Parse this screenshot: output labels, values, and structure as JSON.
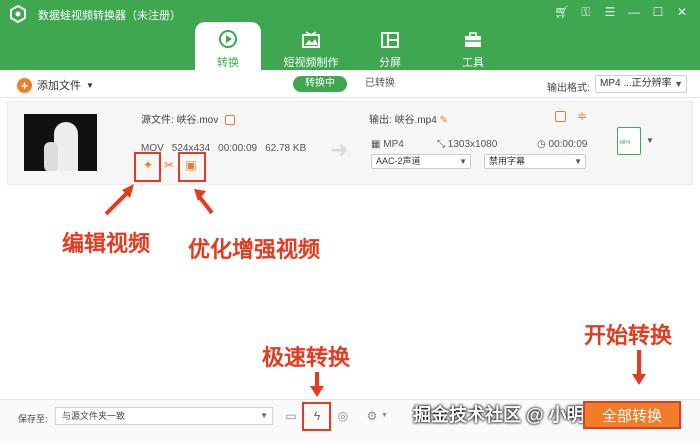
{
  "app": {
    "title": "数据蛙视频转换器（未注册）",
    "accent": "#3ea74f",
    "highlight": "#f07c2a",
    "annotation_color": "#e23b1f"
  },
  "window_controls": [
    "cart-icon",
    "key-icon",
    "menu-icon",
    "minimize-icon",
    "maximize-icon",
    "close-icon"
  ],
  "tabs": [
    {
      "label": "转换",
      "icon": "convert-icon",
      "active": true
    },
    {
      "label": "短视频制作",
      "icon": "mv-icon",
      "active": false
    },
    {
      "label": "分屏",
      "icon": "collage-icon",
      "active": false
    },
    {
      "label": "工具",
      "icon": "toolbox-icon",
      "active": false
    }
  ],
  "toolbar": {
    "add_files": "添加文件",
    "segment_on": "转换中",
    "segment_off": "已转换",
    "format_label": "输出格式:",
    "format_value": "MP4 ...正分辨率"
  },
  "file": {
    "source_label": "源文件:",
    "source_name": "峡谷.mov",
    "format": "MOV",
    "resolution": "524x434",
    "duration": "00:00:09",
    "size": "62.78 KB",
    "output_label": "输出:",
    "output_name": "峡谷.mp4",
    "out_format": "MP4",
    "out_resolution": "1303x1080",
    "out_duration": "00:00:09",
    "audio": "AAC-2声道",
    "subtitle": "禁用字幕",
    "badge": "MP4"
  },
  "annotations": {
    "edit_video": "编辑视频",
    "enhance_video": "优化增强视频",
    "fast_convert": "极速转换",
    "start_convert": "开始转换"
  },
  "bottom": {
    "save_label": "保存至:",
    "save_value": "与源文件夹一致",
    "watermark": "掘金技术社区 @ 小明助手",
    "convert_all": "全部转换"
  }
}
